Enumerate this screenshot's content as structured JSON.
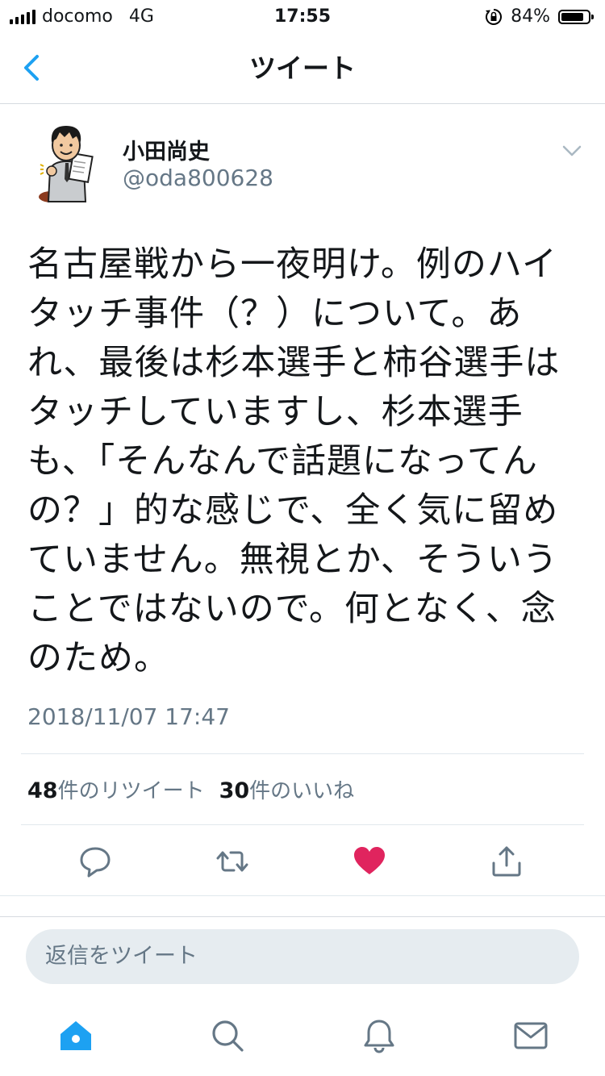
{
  "status_bar": {
    "carrier": "docomo",
    "network": "4G",
    "time": "17:55",
    "battery_text": "84%",
    "battery_level": 0.84
  },
  "nav": {
    "title": "ツイート",
    "back_icon": "chevron-left-icon"
  },
  "tweet": {
    "author_name": "小田尚史",
    "author_handle": "@oda800628",
    "text": "名古屋戦から一夜明け。例のハイ\nタッチ事件（？）について。あ\nれ、最後は杉本選手と柿谷選手は\nタッチしていますし、杉本選手\nも、「そんなんで話題になってん\nの？」的な感じで、全く気に留め\nていません。無視とか、そういう\nことではないので。何となく、念\nのため。",
    "timestamp": "2018/11/07 17:47"
  },
  "stats": {
    "retweet_count": "48",
    "retweet_label": "件のリツイート",
    "like_count": "30",
    "like_label": "件のいいね"
  },
  "actions": [
    "reply-icon",
    "retweet-icon",
    "like-icon",
    "share-icon"
  ],
  "reply": {
    "placeholder": "返信をツイート"
  },
  "tab_bar": [
    "home-icon",
    "search-icon",
    "notifications-icon",
    "messages-icon"
  ],
  "colors": {
    "accent": "#1da1f2",
    "like": "#e0245e",
    "icon_gray": "#657786",
    "divider": "#e1e8ed",
    "reply_bg": "#e6ecf0"
  }
}
